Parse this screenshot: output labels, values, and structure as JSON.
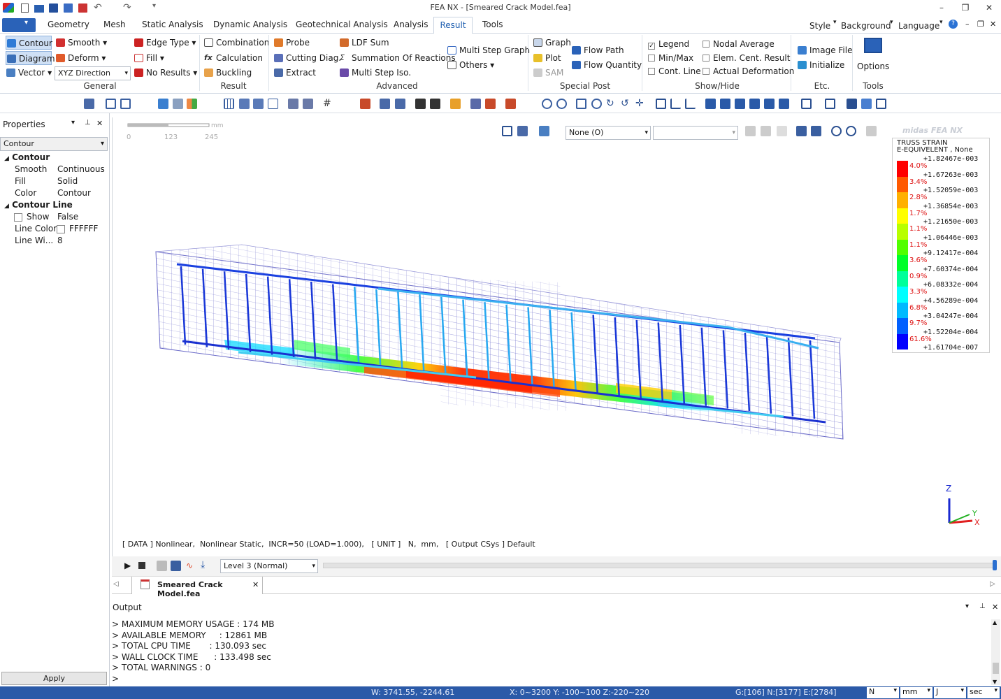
{
  "window": {
    "title": "FEA NX - [Smeared Crack Model.fea]"
  },
  "menu": {
    "tabs": [
      "Geometry",
      "Mesh",
      "Static Analysis",
      "Dynamic Analysis",
      "Geotechnical Analysis",
      "Analysis",
      "Result",
      "Tools"
    ],
    "active": "Result",
    "right": [
      "Style",
      "Background",
      "Language"
    ]
  },
  "ribbon": {
    "general": {
      "label": "General",
      "contour": "Contour",
      "diagram": "Diagram",
      "vector": "Vector",
      "smooth": "Smooth",
      "deform": "Deform",
      "direction": "XYZ Direction",
      "edge_type": "Edge Type",
      "fill": "Fill",
      "no_results": "No Results"
    },
    "result": {
      "label": "Result",
      "combination": "Combination",
      "calculation": "Calculation",
      "buckling": "Buckling"
    },
    "advanced": {
      "label": "Advanced",
      "probe": "Probe",
      "cutting": "Cutting Diag.",
      "extract": "Extract",
      "ldf": "LDF Sum",
      "summation": "Summation Of Reactions",
      "multi_step_iso": "Multi Step Iso.",
      "multi_step_graph": "Multi Step Graph",
      "others": "Others"
    },
    "special_post": {
      "label": "Special Post",
      "graph": "Graph",
      "plot": "Plot",
      "sam": "SAM",
      "flow_path": "Flow Path",
      "flow_quantity": "Flow Quantity"
    },
    "show_hide": {
      "label": "Show/Hide",
      "legend": "Legend",
      "minmax": "Min/Max",
      "cont_line": "Cont. Line",
      "nodal_average": "Nodal Average",
      "elem_cent": "Elem. Cent. Result",
      "actual_deformation": "Actual Deformation",
      "legend_checked": true
    },
    "etc": {
      "label": "Etc.",
      "image_file": "Image File",
      "initialize": "Initialize"
    },
    "tools": {
      "label": "Tools",
      "options": "Options"
    }
  },
  "properties": {
    "title": "Properties",
    "selector": "Contour",
    "sections": [
      {
        "name": "Contour",
        "rows": [
          [
            "Smooth",
            "Continuous"
          ],
          [
            "Fill",
            "Solid"
          ],
          [
            "Color",
            "Contour"
          ]
        ]
      },
      {
        "name": "Contour Line",
        "rows": [
          [
            "Show",
            "False"
          ],
          [
            "Line Color",
            "FFFFFF"
          ],
          [
            "Line Wi...",
            "8"
          ]
        ]
      }
    ],
    "apply": "Apply"
  },
  "viewport": {
    "scale": {
      "unit": "mm",
      "ticks": [
        "0",
        "123",
        "245"
      ]
    },
    "combo1": "None (O)",
    "combo2": "",
    "brand": "midas FEA NX",
    "info_line": "[ DATA ] Nonlinear,  Nonlinear Static,  INCR=50 (LOAD=1.000),   [ UNIT ]   N,  mm,   [ Output CSys ] Default",
    "axes": {
      "z": "Z",
      "y": "Y",
      "x": "X"
    }
  },
  "legend": {
    "title1": "TRUSS STRAIN",
    "title2": "E-EQUIVELENT , None",
    "values": [
      "+1.82467e-003",
      "+1.67263e-003",
      "+1.52059e-003",
      "+1.36854e-003",
      "+1.21650e-003",
      "+1.06446e-003",
      "+9.12417e-004",
      "+7.60374e-004",
      "+6.08332e-004",
      "+4.56289e-004",
      "+3.04247e-004",
      "+1.52204e-004",
      "+1.61704e-007"
    ],
    "percents": [
      "4.0%",
      "3.4%",
      "2.8%",
      "1.7%",
      "1.1%",
      "1.1%",
      "3.6%",
      "0.9%",
      "3.3%",
      "6.8%",
      "9.7%",
      "61.6%"
    ],
    "colors": [
      "#ff0000",
      "#ff5a00",
      "#ffb000",
      "#ffff00",
      "#b8ff00",
      "#50ff00",
      "#00ff28",
      "#00ff9a",
      "#00ffff",
      "#00baff",
      "#0060ff",
      "#0000ff"
    ]
  },
  "playback": {
    "level": "Level 3 (Normal)"
  },
  "document_tab": {
    "name": "Smeared Crack Model.fea"
  },
  "output": {
    "title": "Output",
    "lines": [
      "> MAXIMUM MEMORY USAGE : 174 MB",
      "> AVAILABLE MEMORY     : 12861 MB",
      "> TOTAL CPU TIME       : 130.093 sec",
      "> WALL CLOCK TIME      : 133.498 sec",
      "> TOTAL WARNINGS : 0",
      ">"
    ]
  },
  "status": {
    "w": "W: 3741.55, -2244.61",
    "range": "X: 0~3200 Y: -100~100 Z:-220~220",
    "counts": "G:[106] N:[3177] E:[2784]",
    "units": [
      "N",
      "mm",
      "J",
      "sec"
    ]
  }
}
